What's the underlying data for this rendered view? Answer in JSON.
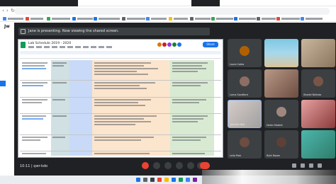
{
  "window": {
    "app_label": "Jw"
  },
  "presentation_banner": {
    "text": "Jane is presenting. Now viewing the shared screen."
  },
  "sheet": {
    "title": "Lab Schedule  2019 - 2020",
    "share_label": "Share"
  },
  "participants": [
    {
      "name": "Laura Cates"
    },
    {
      "name": ""
    },
    {
      "name": ""
    },
    {
      "name": "Lorna Sandford"
    },
    {
      "name": ""
    },
    {
      "name": "Shadel Belinda"
    },
    {
      "name": "Jennifer Bell"
    },
    {
      "name": "Helen Madrid"
    },
    {
      "name": ""
    },
    {
      "name": "Leila Park"
    },
    {
      "name": "Ruth Rosen"
    },
    {
      "name": ""
    }
  ],
  "meet_footer": {
    "clock": "10:11",
    "meeting_code": "qwr-kdo"
  },
  "colors": {
    "meet_bg": "#202124",
    "tile_bg": "#3c4043",
    "end_call": "#ea4335",
    "col_blue": "#c9daf8",
    "col_orange": "#fce5cd",
    "col_green": "#d9ead3",
    "sheet_green": "#0f9d58"
  },
  "icons": [
    "back-icon",
    "forward-icon",
    "reload-icon",
    "sheets-icon",
    "mic-off-icon",
    "camera-icon",
    "captions-icon",
    "present-icon",
    "raise-hand-icon",
    "more-icon",
    "end-call-icon",
    "info-icon",
    "people-icon",
    "chat-icon",
    "activities-icon",
    "windows-start-icon",
    "search-icon"
  ]
}
